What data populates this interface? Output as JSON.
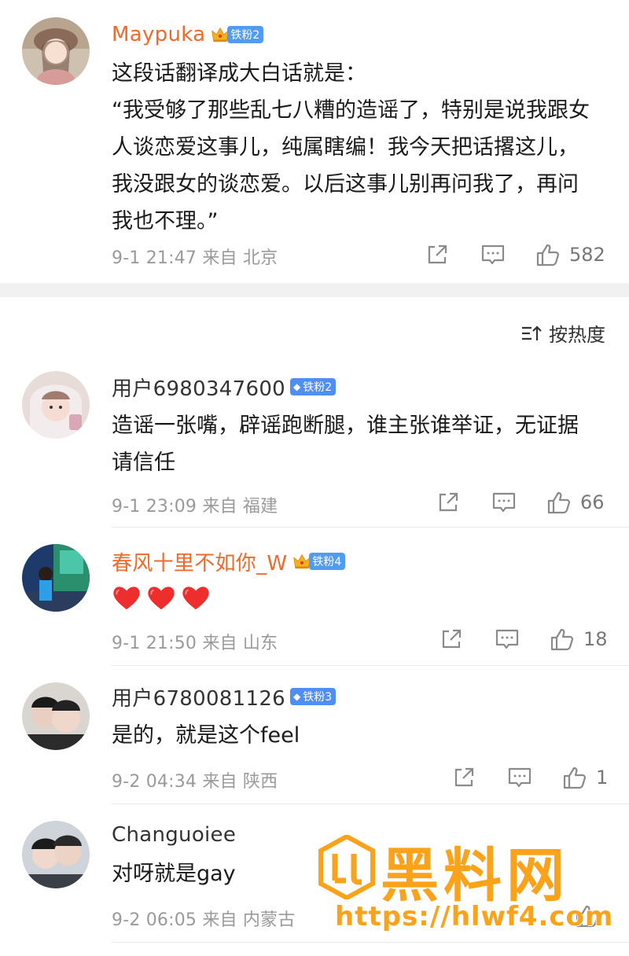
{
  "colors": {
    "vip_name": "#f06a2a",
    "badge_blue": "#4f8ef7",
    "watermark": "#f9a21a",
    "meta_gray": "#9a9a9a"
  },
  "icons": {
    "share": "share-icon",
    "comment": "comment-icon",
    "like": "thumbs-up-icon",
    "sort": "sort-icon",
    "crown": "crown-icon",
    "gem": "diamond-icon"
  },
  "top_comment": {
    "username": "Maypuka",
    "badge": "铁粉2",
    "text": "这段话翻译成大白话就是：\n“我受够了那些乱七八糟的造谣了，特别是说我跟女人谈恋爱这事儿，纯属瞎编！我今天把话撂这儿，我没跟女的谈恋爱。以后这事儿别再问我了，再问我也不理。”",
    "meta": "9-1 21:47 来自 北京",
    "likes": "582"
  },
  "sort": {
    "label": "按热度"
  },
  "comments": [
    {
      "username": "用户6980347600",
      "badge": "铁粉2",
      "text": "造谣一张嘴，辟谣跑断腿，谁主张谁举证，无证据请信任",
      "meta": "9-1 23:09 来自 福建",
      "likes": "66"
    },
    {
      "username": "春风十里不如你_W",
      "badge": "铁粉4",
      "text": "",
      "meta": "9-1 21:50 来自 山东",
      "likes": "18"
    },
    {
      "username": "用户6780081126",
      "badge": "铁粉3",
      "text": "是的，就是这个feel",
      "meta": "9-2 04:34 来自 陕西",
      "likes": "1"
    },
    {
      "username": "Changuoiee",
      "badge": "",
      "text": "对呀就是gay",
      "meta": "9-2 06:05 来自 内蒙古",
      "likes": ""
    }
  ],
  "watermark": {
    "title": "黑料网",
    "url": "https://hlwf4.com"
  }
}
